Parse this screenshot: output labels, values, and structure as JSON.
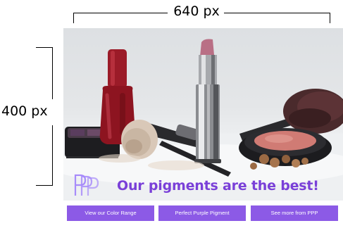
{
  "annotations": {
    "width_label": "640 px",
    "height_label": "400 px"
  },
  "banner": {
    "headline": "Our pigments are the best!",
    "logo": {
      "icon": "ppp-logo-icon",
      "color": "#a78bfa"
    },
    "accent_color": "#7a40d8",
    "button_color": "#8c5ae6",
    "buttons": [
      {
        "label": "View our Color Range"
      },
      {
        "label": "Perfect Purple Pigment"
      },
      {
        "label": "See more from PPP"
      }
    ]
  }
}
